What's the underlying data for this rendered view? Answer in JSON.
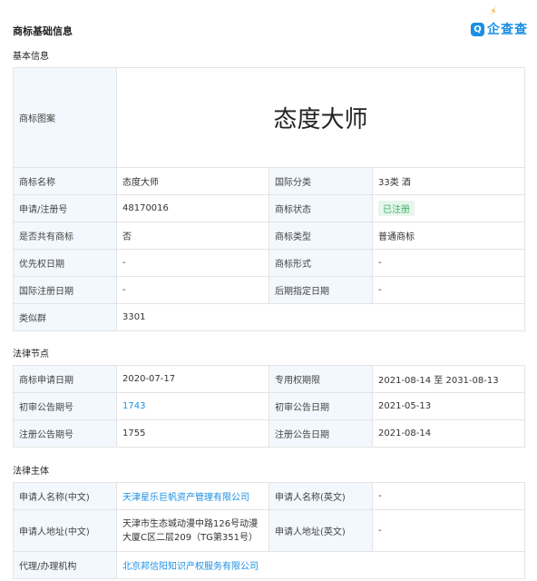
{
  "header": {
    "title": "商标基础信息",
    "logo_text": "企查查",
    "logo_mark": "Q",
    "logo_spark": "⚡"
  },
  "basic": {
    "title": "基本信息",
    "image_label": "商标图案",
    "image_text": "态度大师",
    "rows": [
      {
        "l1": "商标名称",
        "v1": "态度大师",
        "l2": "国际分类",
        "v2": "33类 酒"
      },
      {
        "l1": "申请/注册号",
        "v1": "48170016",
        "l2": "商标状态",
        "v2": "已注册"
      },
      {
        "l1": "是否共有商标",
        "v1": "否",
        "l2": "商标类型",
        "v2": "普通商标"
      },
      {
        "l1": "优先权日期",
        "v1": "-",
        "l2": "商标形式",
        "v2": "-"
      },
      {
        "l1": "国际注册日期",
        "v1": "-",
        "l2": "后期指定日期",
        "v2": "-"
      }
    ],
    "similar_label": "类似群",
    "similar_value": "3301"
  },
  "legal": {
    "title": "法律节点",
    "rows": [
      {
        "l1": "商标申请日期",
        "v1": "2020-07-17",
        "l2": "专用权期限",
        "v2": "2021-08-14 至 2031-08-13"
      },
      {
        "l1": "初审公告期号",
        "v1": "1743",
        "l2": "初审公告日期",
        "v2": "2021-05-13"
      },
      {
        "l1": "注册公告期号",
        "v1": "1755",
        "l2": "注册公告日期",
        "v2": "2021-08-14"
      }
    ]
  },
  "subject": {
    "title": "法律主体",
    "rows": [
      {
        "l1": "申请人名称(中文)",
        "v1": "天津星乐巨帆资产管理有限公司",
        "l2": "申请人名称(英文)",
        "v2": "-"
      },
      {
        "l1": "申请人地址(中文)",
        "v1": "天津市生态城动漫中路126号动漫大厦C区二层209（TG第351号）",
        "l2": "申请人地址(英文)",
        "v2": "-"
      }
    ],
    "agent_label": "代理/办理机构",
    "agent_value": "北京邦信阳知识产权服务有限公司"
  },
  "colors": {
    "link": "#1a8fe3",
    "label_bg": "#f2f8fd",
    "status_green": "#3bb069"
  }
}
